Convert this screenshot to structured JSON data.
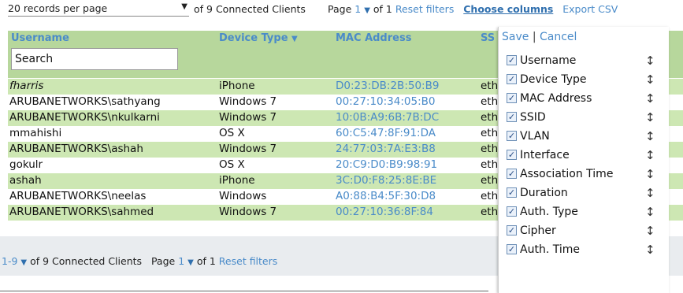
{
  "toolbar": {
    "per_page": "20 records per page",
    "count_text": "of 9 Connected Clients",
    "page_label": "Page",
    "page_num": "1",
    "page_of": "of 1",
    "reset": "Reset filters",
    "choose_columns": "Choose columns",
    "export": "Export CSV"
  },
  "columns": {
    "username": "Username",
    "device_type": "Device Type",
    "mac": "MAC Address",
    "ssid": "SS"
  },
  "search": {
    "value": "Search"
  },
  "rows": [
    {
      "user": "fharris",
      "device": "iPhone",
      "mac": "D0:23:DB:2B:50:B9",
      "ssid": "eth"
    },
    {
      "user": "ARUBANETWORKS\\sathyang",
      "device": "Windows 7",
      "mac": "00:27:10:34:05:B0",
      "ssid": "eth"
    },
    {
      "user": "ARUBANETWORKS\\nkulkarni",
      "device": "Windows 7",
      "mac": "10:0B:A9:6B:7B:DC",
      "ssid": "eth"
    },
    {
      "user": "mmahishi",
      "device": "OS X",
      "mac": "60:C5:47:8F:91:DA",
      "ssid": "eth"
    },
    {
      "user": "ARUBANETWORKS\\ashah",
      "device": "Windows 7",
      "mac": "24:77:03:7A:E3:B8",
      "ssid": "eth"
    },
    {
      "user": "gokulr",
      "device": "OS X",
      "mac": "20:C9:D0:B9:98:91",
      "ssid": "eth"
    },
    {
      "user": "ashah",
      "device": "iPhone",
      "mac": "3C:D0:F8:25:8E:BE",
      "ssid": "eth"
    },
    {
      "user": "ARUBANETWORKS\\neelas",
      "device": "Windows",
      "mac": "A0:88:B4:5F:30:D8",
      "ssid": "eth"
    },
    {
      "user": "ARUBANETWORKS\\sahmed",
      "device": "Windows 7",
      "mac": "00:27:10:36:8F:84",
      "ssid": "eth"
    }
  ],
  "footer": {
    "range": "1-9",
    "count_text": "of 9 Connected Clients",
    "page_label": "Page",
    "page_num": "1",
    "page_of": "of 1",
    "reset": "Reset filters"
  },
  "panel": {
    "save": "Save",
    "separator": "|",
    "cancel": "Cancel",
    "options": [
      "Username",
      "Device Type",
      "MAC Address",
      "SSID",
      "VLAN",
      "Interface",
      "Association Time",
      "Duration",
      "Auth. Type",
      "Cipher",
      "Auth. Time"
    ]
  },
  "colors": {
    "header_bg": "#b7d79c",
    "row_alt_bg": "#cde7b3",
    "link": "#4a8bc9"
  }
}
